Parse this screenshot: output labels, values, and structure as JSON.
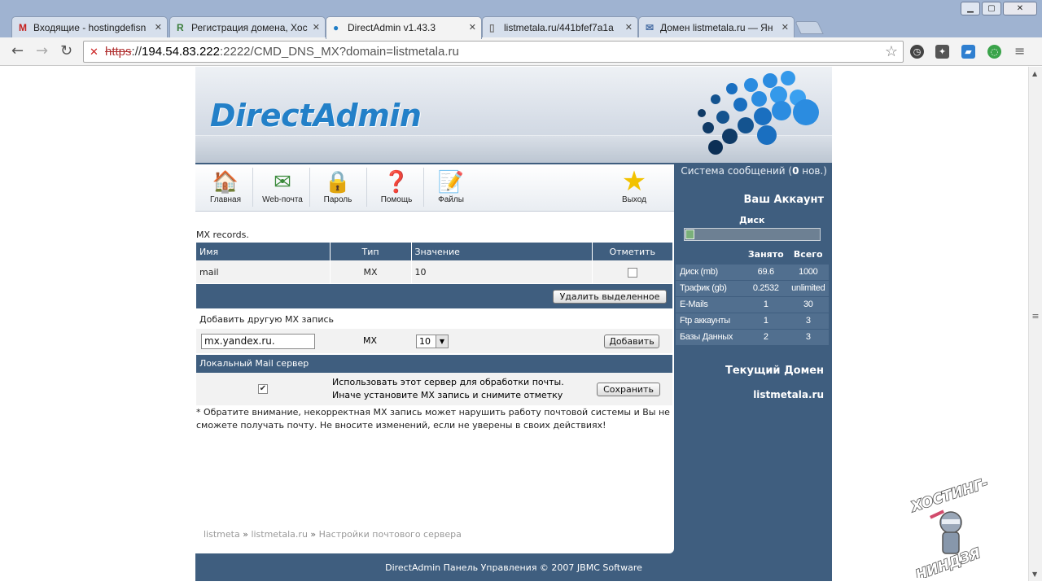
{
  "browser": {
    "tabs": [
      {
        "icon": "gmail-icon",
        "favicon_text": "M",
        "favicon_color": "#c5221f",
        "label": "Входящие - hostingdefisn"
      },
      {
        "icon": "reg-ru-icon",
        "favicon_text": "R",
        "favicon_color": "#3a7d3a",
        "label": "Регистрация домена, Хос"
      },
      {
        "icon": "directadmin-icon",
        "favicon_text": "●",
        "favicon_color": "#1f7dc6",
        "label": "DirectAdmin v1.43.3"
      },
      {
        "icon": "page-icon",
        "favicon_text": "▯",
        "favicon_color": "#777777",
        "label": "listmetala.ru/441bfef7a1a"
      },
      {
        "icon": "mail-icon",
        "favicon_text": "✉",
        "favicon_color": "#4a6fa5",
        "label": "Домен listmetala.ru — Ян"
      }
    ],
    "address": {
      "scheme": "https",
      "host": "194.54.83.222",
      "rest": ":2222/CMD_DNS_MX?domain=listmetala.ru"
    }
  },
  "app": {
    "logo": "DirectAdmin"
  },
  "menu": [
    {
      "icon": "home-icon",
      "glyph": "🏠",
      "label": "Главная"
    },
    {
      "icon": "webmail-icon",
      "glyph": "✉",
      "label": "Web-почта"
    },
    {
      "icon": "lock-icon",
      "glyph": "🔒",
      "label": "Пароль"
    },
    {
      "icon": "help-icon",
      "glyph": "❓",
      "label": "Помощь"
    },
    {
      "icon": "files-icon",
      "glyph": "📝",
      "label": "Файлы"
    },
    {
      "icon": "logout-star-icon",
      "glyph": "★",
      "label": "Выход"
    }
  ],
  "mx": {
    "caption": "MX records.",
    "headers": [
      "Имя",
      "Тип",
      "Значение",
      "Отметить"
    ],
    "rows": [
      {
        "name": "mail",
        "type": "MX",
        "value": "10",
        "checked": false
      }
    ],
    "delete_button": "Удалить выделенное",
    "add_caption": "Добавить другую MX запись",
    "add_input_value": "mx.yandex.ru.",
    "add_type": "MX",
    "add_priority": "10",
    "add_button": "Добавить"
  },
  "local_mail": {
    "header": "Локальный Mail сервер",
    "checked": true,
    "text_line1": "Использовать этот сервер для обработки почты.",
    "text_line2": "Иначе установите MX запись и снимите отметку",
    "save_button": "Сохранить"
  },
  "note": "* Обратите внимание, некорректная MX запись может нарушить работу почтовой системы и Вы не сможете получать почту. Не вносите изменений, если не уверены в своих действиях!",
  "breadcrumbs": [
    "listmeta",
    "listmetala.ru",
    "Настройки почтового сервера"
  ],
  "breadcrumb_separator": "»",
  "sidebar": {
    "messages_prefix": "Система сообщений (",
    "messages_count": "0",
    "messages_suffix": " нов.)",
    "account_title": "Ваш Аккаунт",
    "disk_label": "Диск",
    "disk_usage_fraction": 0.07,
    "stats_headers": [
      "Занято",
      "Всего"
    ],
    "stats": [
      {
        "label": "Диск (mb)",
        "used": "69.6",
        "total": "1000"
      },
      {
        "label": "Трафик (gb)",
        "used": "0.2532",
        "total": "unlimited"
      },
      {
        "label": "E-Mails",
        "used": "1",
        "total": "30"
      },
      {
        "label": "Ftp аккаунты",
        "used": "1",
        "total": "3"
      },
      {
        "label": "Базы Данных",
        "used": "2",
        "total": "3"
      }
    ],
    "current_domain_title": "Текущий Домен",
    "current_domain": "listmetala.ru"
  },
  "footer": "DirectAdmin Панель Управления © 2007 JBMC Software",
  "watermark": {
    "line1": "ХОСТИНГ-",
    "line2": "НИНДЗЯ"
  }
}
